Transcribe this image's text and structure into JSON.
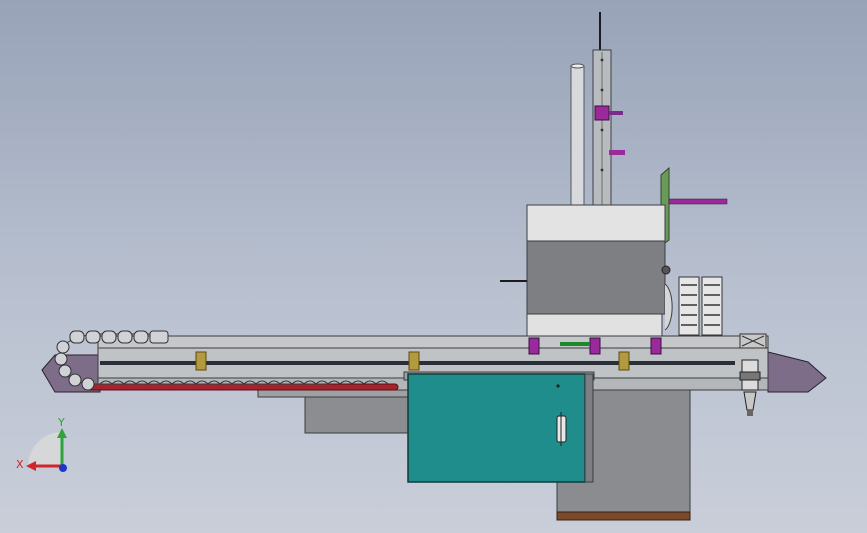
{
  "viewport": {
    "background_top": "#98a3b8",
    "background_bottom": "#c9ced9"
  },
  "model_colors": {
    "frame": "#b9bcc0",
    "frame_dark": "#2a2e36",
    "end_cap": "#7e6d88",
    "carriage_top": "#e3e3e3",
    "carriage_body": "#7d7f82",
    "control_cabinet": "#1f8d8b",
    "base_block": "#8a8c8f",
    "base_foot": "#7a4a2a",
    "belt": "#a4232c",
    "cable_chain": "#bfc2c6",
    "clamp": "#9a2a9c",
    "bracket": "#6b9a58",
    "limit_sensor": "#b39a3e",
    "sensor_green": "#1d8a2a"
  },
  "triad": {
    "x_label": "X",
    "y_label": "Y",
    "x_color": "#d0262b",
    "y_color": "#2ea43a",
    "z_color": "#1b39c8"
  }
}
